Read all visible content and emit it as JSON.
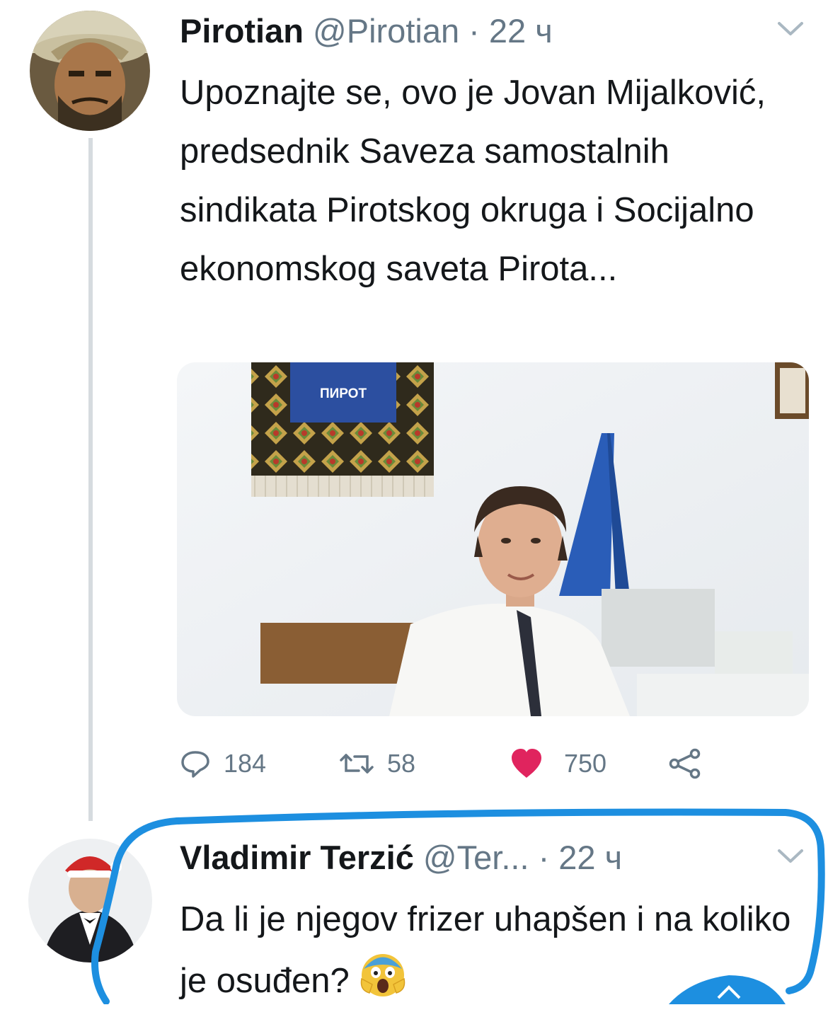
{
  "tweet": {
    "author_name": "Pirotian",
    "author_handle": "@Pirotian",
    "time": "· 22 ч",
    "text": "Upoznajte se, ovo je Jovan Mijalković, predsednik Saveza samostalnih sindikata Pirotskog okruga i Socijalno ekonomskog saveta Pirota...",
    "image_rug_text": "ПИРОТ",
    "replies": "184",
    "retweets": "58",
    "likes": "750",
    "avatar_icon": "person-avatar",
    "like_color": "#e0245e"
  },
  "reply": {
    "author_name": "Vladimir Terzić",
    "author_handle": "@Ter...",
    "time": "· 22 ч",
    "text": "Da li je njegov frizer uhapšen i na koliko je osuđen?",
    "emoji": "screaming-face-emoji",
    "highlight_color": "#1d8fe0"
  },
  "icons": {
    "reply": "reply-bubble-icon",
    "retweet": "retweet-icon",
    "like": "heart-icon",
    "share": "share-icon",
    "more": "chevron-down-icon"
  }
}
